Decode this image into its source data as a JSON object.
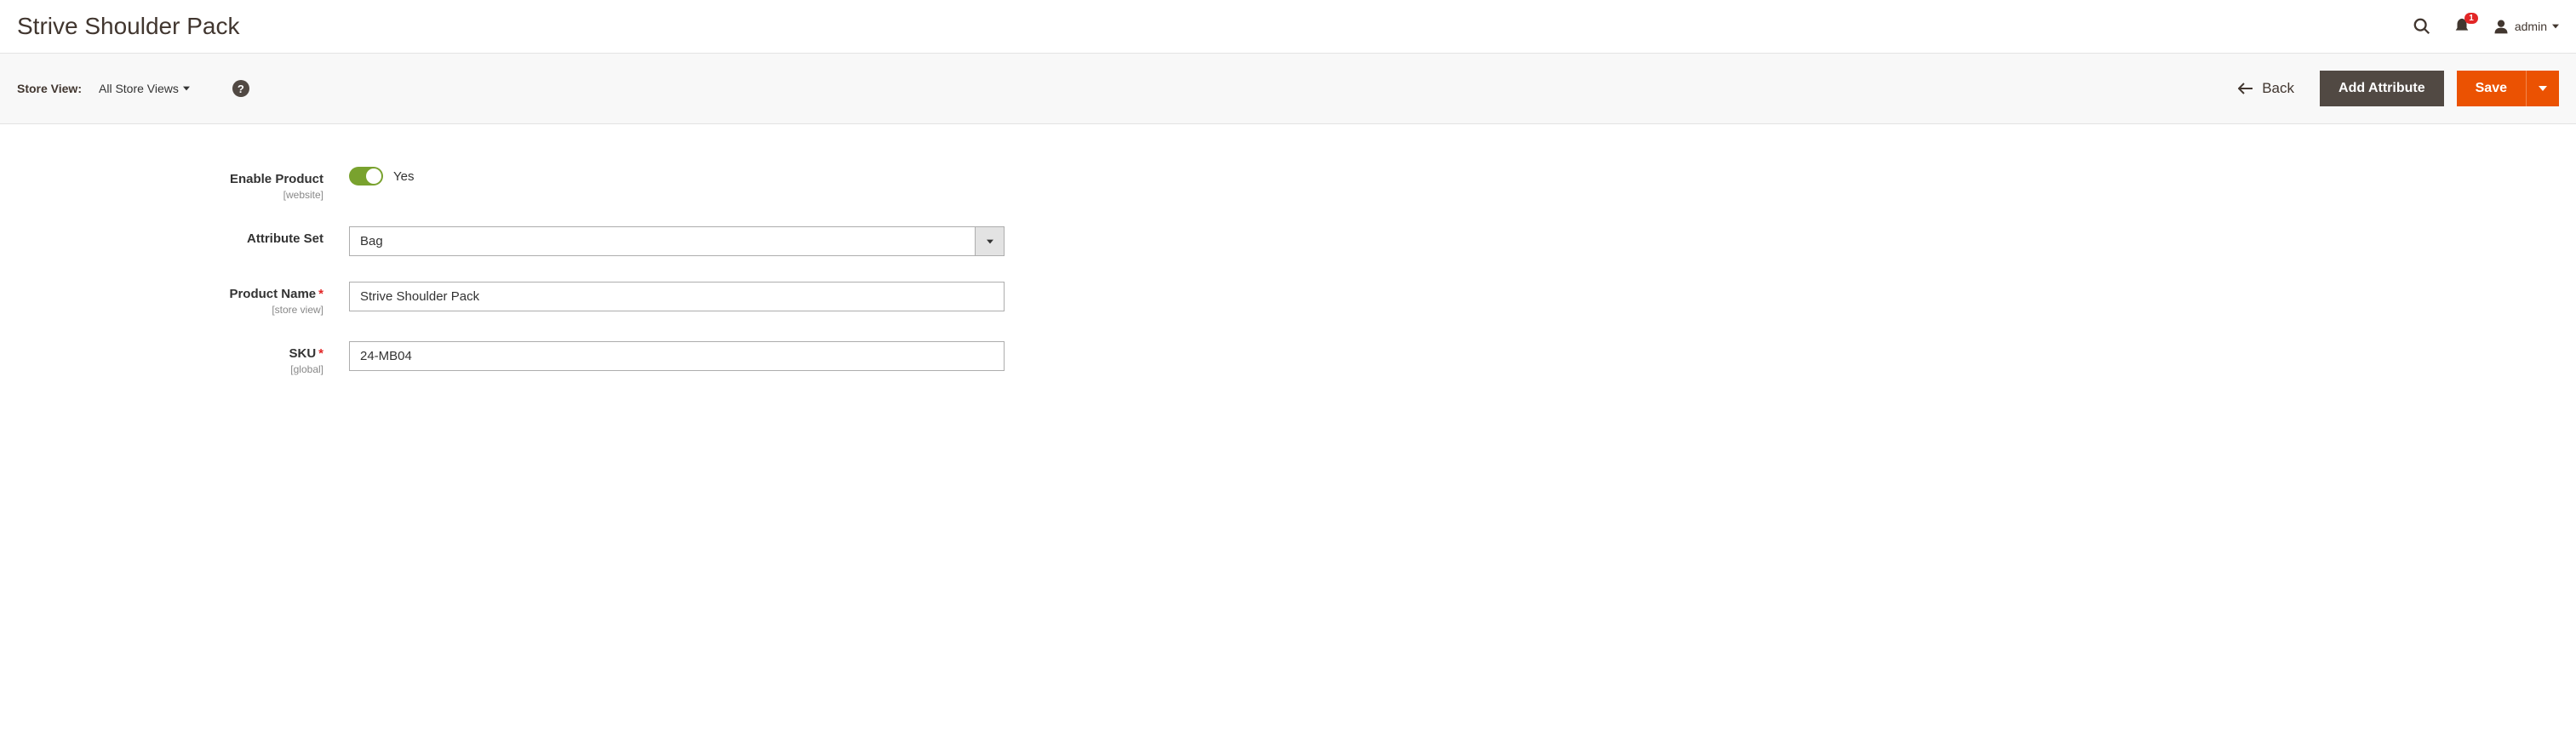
{
  "header": {
    "page_title": "Strive Shoulder Pack",
    "notification_count": "1",
    "user_name": "admin"
  },
  "toolbar": {
    "store_view_label": "Store View:",
    "store_view_value": "All Store Views",
    "back_label": "Back",
    "add_attribute_label": "Add Attribute",
    "save_label": "Save"
  },
  "form": {
    "enable_product": {
      "label": "Enable Product",
      "scope": "[website]",
      "value": "Yes"
    },
    "attribute_set": {
      "label": "Attribute Set",
      "value": "Bag"
    },
    "product_name": {
      "label": "Product Name",
      "scope": "[store view]",
      "value": "Strive Shoulder Pack"
    },
    "sku": {
      "label": "SKU",
      "scope": "[global]",
      "value": "24-MB04"
    }
  }
}
